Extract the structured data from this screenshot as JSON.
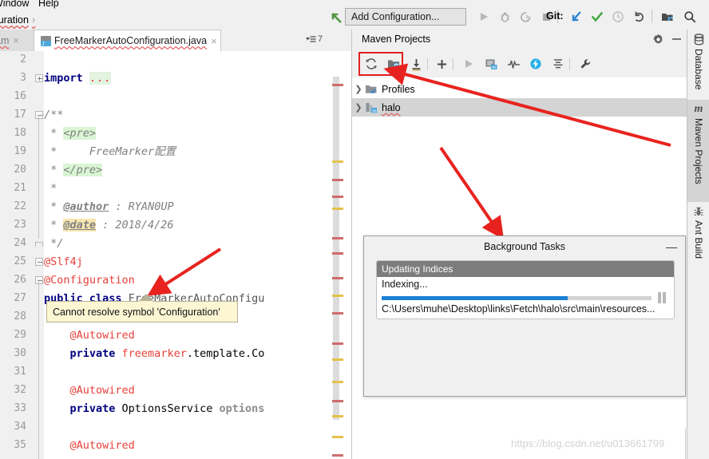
{
  "menubar": {
    "items": [
      "Window",
      "Help"
    ]
  },
  "breadcrumb": {
    "text": "iguration",
    "separator": "›"
  },
  "toolbar": {
    "back_icon": "back-arrow-icon",
    "add_configuration_label": "Add Configuration...",
    "run_icon": "run-icon",
    "debug_icon": "debug-icon",
    "run_coverage_icon": "run-with-coverage-icon",
    "stop_icon": "stop-icon",
    "git_label": "Git:",
    "update_project_icon": "update-project-icon",
    "commit_icon": "commit-checkmark-icon",
    "history_icon": "history-clock-icon",
    "rollback_icon": "rollback-undo-icon",
    "project_structure_icon": "project-structure-icon",
    "search_icon": "search-icon"
  },
  "editor_tabs": {
    "inactive_tab_label": "am",
    "active_tab_label": "FreeMarkerAutoConfiguration.java",
    "close_glyph": "×",
    "options_count": "7"
  },
  "editor": {
    "line_numbers": [
      "2",
      "3",
      "16",
      "17",
      "18",
      "19",
      "20",
      "21",
      "22",
      "23",
      "24",
      "25",
      "26",
      "27",
      "28",
      "29",
      "30",
      "31",
      "32",
      "33",
      "34",
      "35"
    ],
    "lines": [
      {
        "num": "2",
        "text": ""
      },
      {
        "num": "3",
        "text": "import ..."
      },
      {
        "num": "16",
        "text": ""
      },
      {
        "num": "17",
        "text": "/**"
      },
      {
        "num": "18",
        "text": " * <pre>"
      },
      {
        "num": "19",
        "text": " *     FreeMarker配置"
      },
      {
        "num": "20",
        "text": " * </pre>"
      },
      {
        "num": "21",
        "text": " *"
      },
      {
        "num": "22",
        "text": " * @author : RYAN0UP"
      },
      {
        "num": "23",
        "text": " * @date : 2018/4/26"
      },
      {
        "num": "24",
        "text": " */"
      },
      {
        "num": "25",
        "text": "@Slf4j"
      },
      {
        "num": "26",
        "text": "@Configuration"
      },
      {
        "num": "27",
        "text": "public class FreeMarkerAutoConfigu"
      },
      {
        "num": "28",
        "text": ""
      },
      {
        "num": "29",
        "text": "    @Autowired"
      },
      {
        "num": "30",
        "text": "    private freemarker.template.Co"
      },
      {
        "num": "31",
        "text": ""
      },
      {
        "num": "32",
        "text": "    @Autowired"
      },
      {
        "num": "33",
        "text": "    private OptionsService options"
      },
      {
        "num": "34",
        "text": ""
      },
      {
        "num": "35",
        "text": "    @Autowired"
      }
    ],
    "tooltip_text": "Cannot resolve symbol 'Configuration'"
  },
  "maven_panel": {
    "title": "Maven Projects",
    "gear_icon": "settings-gear-icon",
    "minimize_icon": "minimize-icon",
    "toolbar_icons": [
      "reimport-refresh-icon",
      "generate-sources-folder-icon",
      "download-sources-icon",
      "add-maven-project-icon",
      "run-maven-build-icon",
      "execute-maven-goal-icon",
      "toggle-skip-tests-icon",
      "toggle-offline-mode-icon",
      "collapse-all-icon",
      "maven-settings-wrench-icon"
    ],
    "tree": [
      {
        "label": "Profiles",
        "icon": "profiles-folder-icon",
        "expanded": false,
        "selected": false
      },
      {
        "label": "halo",
        "icon": "maven-module-icon",
        "expanded": false,
        "selected": true
      }
    ]
  },
  "background_tasks": {
    "title": "Background Tasks",
    "minimize_glyph": "—",
    "task_name": "Updating Indices",
    "status": "Indexing...",
    "progress_percent": 69,
    "path": "C:\\Users\\muhe\\Desktop\\links\\Fetch\\halo\\src\\main\\resources...",
    "pause_icon": "pause-icon",
    "progress_color": "#1a7fd4"
  },
  "right_tool_bar": {
    "buttons": [
      {
        "label": "Database",
        "icon": "database-icon",
        "active": false
      },
      {
        "label": "Maven Projects",
        "icon": "maven-m-icon",
        "active": true
      },
      {
        "label": "Ant Build",
        "icon": "ant-build-icon",
        "active": false
      }
    ]
  },
  "watermark": {
    "text": "https://blog.csdn.net/u013661799"
  },
  "annotations": {
    "red_box_label": "highlight-box-maven-reimport",
    "arrow_count": 3
  }
}
